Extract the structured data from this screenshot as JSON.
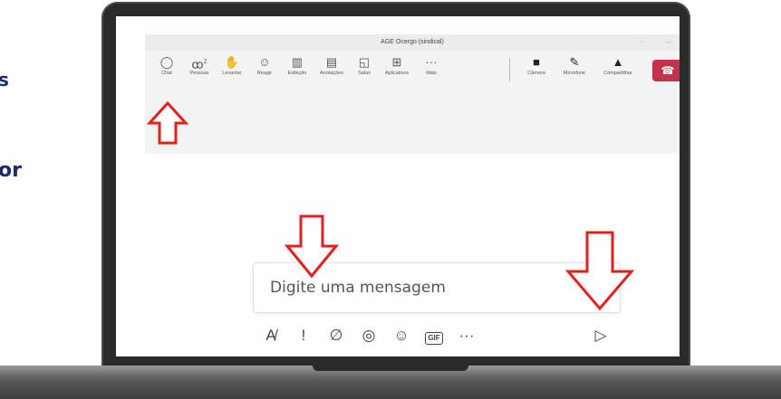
{
  "side_fragments": [
    "s",
    "or"
  ],
  "window": {
    "title": "AGE Ocergo (sindical)",
    "menu_dots": "···",
    "min": "—"
  },
  "toolbar": {
    "items": [
      {
        "label": "Chat",
        "icon": "chat-icon",
        "glyph": "◯"
      },
      {
        "label": "Pessoas",
        "icon": "people-icon",
        "glyph": "ꝏ",
        "count": "2"
      },
      {
        "label": "Levantar",
        "icon": "raise-hand-icon",
        "glyph": "✋"
      },
      {
        "label": "Reagir",
        "icon": "react-icon",
        "glyph": "☺"
      },
      {
        "label": "Exibição",
        "icon": "view-icon",
        "glyph": "▥"
      },
      {
        "label": "Anotações",
        "icon": "notes-icon",
        "glyph": "▤"
      },
      {
        "label": "Salas",
        "icon": "rooms-icon",
        "glyph": "◱"
      },
      {
        "label": "Aplicativos",
        "icon": "apps-icon",
        "glyph": "⊞"
      },
      {
        "label": "Mais",
        "icon": "more-icon",
        "glyph": "···"
      },
      {
        "label": "Câmera",
        "icon": "camera-icon",
        "glyph": "■"
      },
      {
        "label": "Microfone",
        "icon": "microphone-icon",
        "glyph": "✎"
      },
      {
        "label": "Compartilhar",
        "icon": "share-icon",
        "glyph": "▲"
      }
    ],
    "hangup_icon": "phone-hangup-icon",
    "hangup_glyph": "☎"
  },
  "message": {
    "placeholder": "Digite uma mensagem"
  },
  "compose": [
    {
      "icon": "format-icon",
      "glyph": "A̸"
    },
    {
      "icon": "important-icon",
      "glyph": "!"
    },
    {
      "icon": "attach-icon",
      "glyph": "∅"
    },
    {
      "icon": "loop-icon",
      "glyph": "◎"
    },
    {
      "icon": "emoji-icon",
      "glyph": "☺"
    },
    {
      "icon": "gif-icon",
      "glyph": "GIF"
    },
    {
      "icon": "more-options-icon",
      "glyph": "···"
    },
    {
      "icon": "send-icon",
      "glyph": "▷"
    }
  ],
  "colors": {
    "arrow": "#e3201b",
    "hangup": "#c4314b",
    "side_text": "#1f2a6b"
  }
}
